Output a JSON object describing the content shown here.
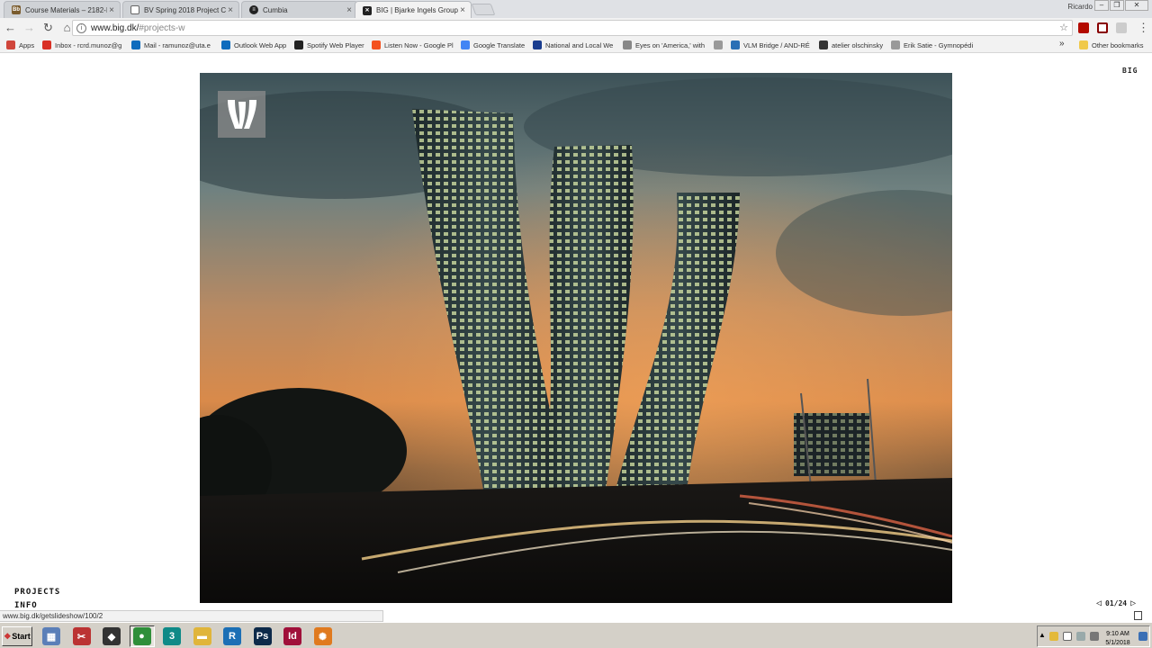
{
  "browser": {
    "tabs": [
      {
        "title": "Course Materials – 2182-Ill",
        "favicon": "bb-icon",
        "active": false
      },
      {
        "title": "BV Spring 2018 Project C_I",
        "favicon": "doc-icon",
        "active": false
      },
      {
        "title": "Cumbia",
        "favicon": "spotify-icon",
        "active": false
      },
      {
        "title": "BIG | Bjarke Ingels Group",
        "favicon": "big-icon",
        "active": true
      }
    ],
    "profile_name": "Ricardo",
    "url_host": "www.big.dk/",
    "url_path": "#projects-w",
    "bookmarks": [
      {
        "label": "Apps",
        "icon": "apps-grid-icon",
        "color": "#d0463b"
      },
      {
        "label": "Inbox - rcrd.munoz@g",
        "icon": "gmail-icon",
        "color": "#d93025"
      },
      {
        "label": "Mail - ramunoz@uta.e",
        "icon": "outlook-icon",
        "color": "#0f6cbd"
      },
      {
        "label": "Outlook Web App",
        "icon": "outlook-icon",
        "color": "#0f6cbd"
      },
      {
        "label": "Spotify Web Player",
        "icon": "spotify-icon",
        "color": "#222222"
      },
      {
        "label": "Listen Now - Google Pl",
        "icon": "play-music-icon",
        "color": "#f4511e"
      },
      {
        "label": "Google Translate",
        "icon": "translate-icon",
        "color": "#4285f4"
      },
      {
        "label": "National and Local We",
        "icon": "weather-icon",
        "color": "#1a3d8f"
      },
      {
        "label": "Eyes on 'America,' with",
        "icon": "google-icon",
        "color": "#888888"
      },
      {
        "label": "",
        "icon": "page-icon",
        "color": "#999999"
      },
      {
        "label": "VLM Bridge / AND-RÉ",
        "icon": "vlm-icon",
        "color": "#2a6fb5"
      },
      {
        "label": "atelier olschinsky",
        "icon": "ao-icon",
        "color": "#333333"
      },
      {
        "label": "Erik Satie - Gymnopédi",
        "icon": "page-icon",
        "color": "#999999"
      }
    ],
    "overflow": "»",
    "other_bookmarks": "Other bookmarks",
    "status_url": "www.big.dk/getslideshow/100/2"
  },
  "page": {
    "brand": "BIG",
    "project_logo_letter": "W",
    "nav": [
      "PROJECTS",
      "INFO"
    ],
    "slide_counter": "01/24",
    "prev_label": "◁",
    "next_label": "▷",
    "accent_color": "#222222"
  },
  "taskbar": {
    "start_label": "Start",
    "apps": [
      {
        "name": "calculator-icon",
        "glyph": "▦",
        "color": "#5b7fb8"
      },
      {
        "name": "snipping-tool-icon",
        "glyph": "✂",
        "color": "#b33"
      },
      {
        "name": "inkscape-icon",
        "glyph": "◆",
        "color": "#333"
      },
      {
        "name": "chrome-icon",
        "glyph": "●",
        "color": "#2f8f3a"
      },
      {
        "name": "3ds-icon",
        "glyph": "3",
        "color": "#0f8a87"
      },
      {
        "name": "explorer-icon",
        "glyph": "▬",
        "color": "#e0b53a"
      },
      {
        "name": "revit-icon",
        "glyph": "R",
        "color": "#1c6fb5"
      },
      {
        "name": "photoshop-icon",
        "glyph": "Ps",
        "color": "#0d2a4a"
      },
      {
        "name": "indesign-icon",
        "glyph": "Id",
        "color": "#a0103a"
      },
      {
        "name": "sketchup-icon",
        "glyph": "✺",
        "color": "#e07a1f"
      }
    ],
    "clock_time": "9:10 AM",
    "clock_date": "5/1/2018"
  }
}
